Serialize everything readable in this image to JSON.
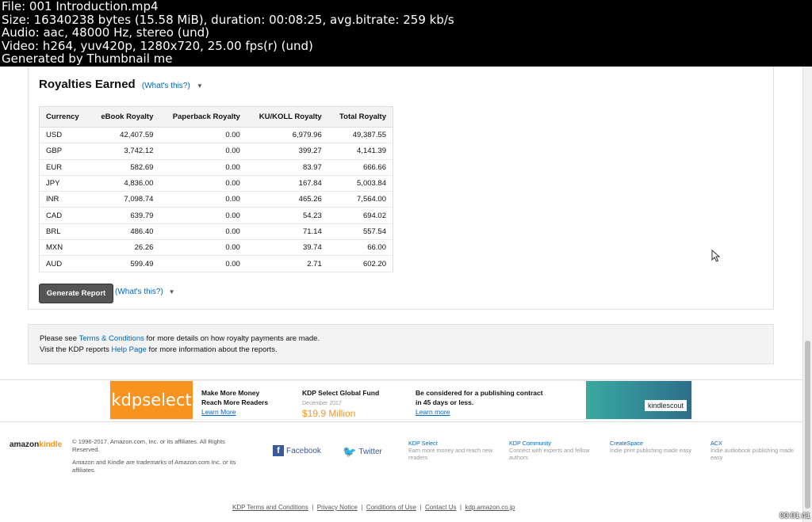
{
  "header_overlay": [
    "File: 001 Introduction.mp4",
    "Size: 16340238 bytes (15.58 MiB), duration: 00:08:25, avg.bitrate: 259 kb/s",
    "Audio: aac, 48000 Hz, stereo (und)",
    "Video: h264, yuv420p, 1280x720, 25.00 fps(r) (und)",
    "Generated by Thumbnail me"
  ],
  "royalties": {
    "title": "Royalties Earned",
    "whats_this": "(What's this?)",
    "columns": [
      "Currency",
      "eBook Royalty",
      "Paperback Royalty",
      "KU/KOLL Royalty",
      "Total Royalty"
    ],
    "rows": [
      [
        "USD",
        "42,407.59",
        "0.00",
        "6,979.96",
        "49,387.55"
      ],
      [
        "GBP",
        "3,742.12",
        "0.00",
        "399.27",
        "4,141.39"
      ],
      [
        "EUR",
        "582.69",
        "0.00",
        "83.97",
        "666.66"
      ],
      [
        "JPY",
        "4,836.00",
        "0.00",
        "167.84",
        "5,003.84"
      ],
      [
        "INR",
        "7,098.74",
        "0.00",
        "465.26",
        "7,564.00"
      ],
      [
        "CAD",
        "639.79",
        "0.00",
        "54.23",
        "694.02"
      ],
      [
        "BRL",
        "486.40",
        "0.00",
        "71.14",
        "557.54"
      ],
      [
        "MXN",
        "26.26",
        "0.00",
        "39.74",
        "66.00"
      ],
      [
        "AUD",
        "599.49",
        "0.00",
        "2.71",
        "602.20"
      ]
    ],
    "generate_button": "Generate Report",
    "generate_whats": "(What's this?)"
  },
  "notice": {
    "line1_pre": "Please see ",
    "line1_link": "Terms & Conditions",
    "line1_post": " for more details on how royalty payments are made.",
    "line2_pre": "Visit the KDP reports ",
    "line2_link": "Help Page",
    "line2_post": " for more information about the reports."
  },
  "banner": {
    "logo": "kdpselect",
    "col1_title": "Make More Money",
    "col1_sub": "Reach More Readers",
    "col1_link": "Learn More",
    "col2_title": "KDP Select Global Fund",
    "col2_date": "December 2017",
    "col2_amount": "$19.9 Million",
    "col3_title": "Be considered for a publishing contract",
    "col3_sub": "in 45 days or less.",
    "col3_link": "Learn more",
    "scout_label": "kindlescout"
  },
  "footer": {
    "brand_a": "amazon",
    "brand_b": "kindle",
    "copyright": "© 1996-2017, Amazon.com, Inc. or its affiliates. All Rights Reserved.",
    "trademark": "Amazon and Kindle are trademarks of Amazon.com Inc. or its affiliates.",
    "facebook": "Facebook",
    "twitter": "Twitter",
    "cols": [
      {
        "title": "KDP Select",
        "desc": "Earn more money and reach new readers"
      },
      {
        "title": "KDP Community",
        "desc": "Connect with experts and fellow authors"
      },
      {
        "title": "CreateSpace",
        "desc": "Indie print publishing made easy"
      },
      {
        "title": "ACX",
        "desc": "Indie audiobook publishing made easy"
      }
    ],
    "links": [
      "KDP Terms and Conditions",
      "Privacy Notice",
      "Conditions of Use",
      "Contact Us",
      "kdp.amazon.co.jp"
    ]
  },
  "timecode": "00:01:41"
}
